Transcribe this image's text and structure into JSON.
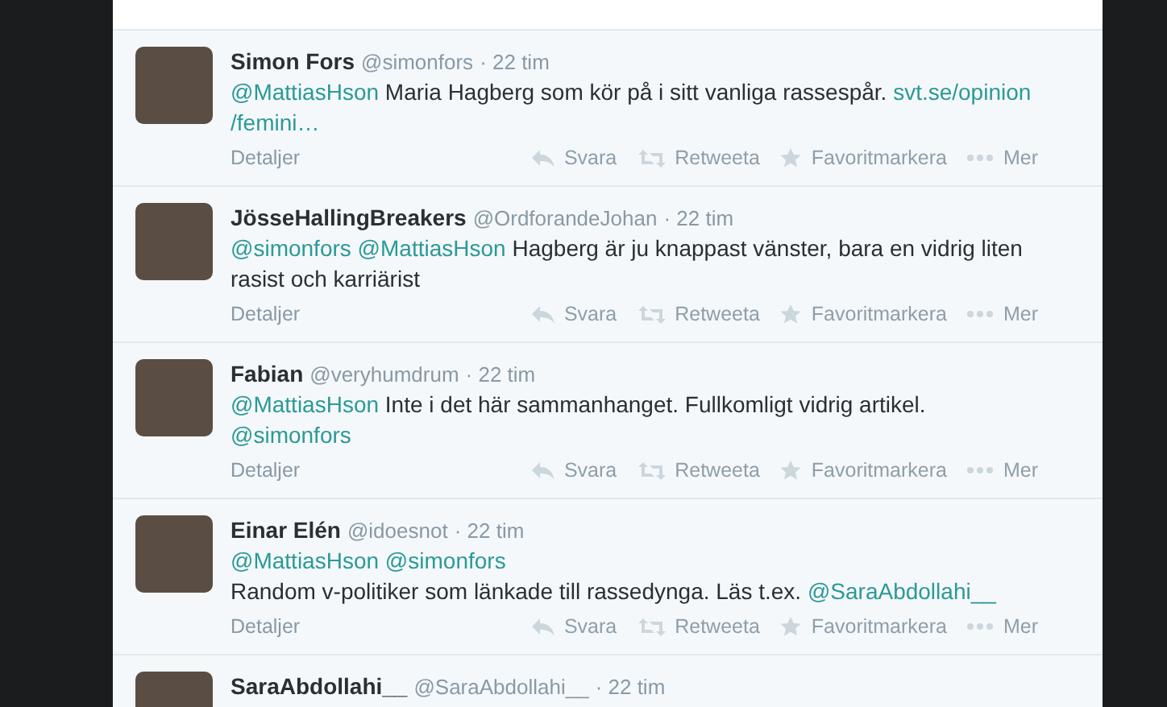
{
  "tweets": [
    {
      "name": "Simon Fors",
      "handle": "@simonfors",
      "time": "· 22 tim",
      "lines": [
        [
          {
            "kind": "mention",
            "text": "@MattiasHson"
          },
          {
            "kind": "text",
            "text": "Maria Hagberg som kör på i sitt vanliga rassespår."
          },
          {
            "kind": "link",
            "text": "svt.se/opinion"
          }
        ],
        [
          {
            "kind": "link",
            "text": "/femini…"
          }
        ]
      ],
      "details": "Detaljer",
      "actions": [
        {
          "kind": "reply",
          "label": "Svara"
        },
        {
          "kind": "retweet",
          "label": "Retweeta"
        },
        {
          "kind": "favorite",
          "label": "Favoritmarkera"
        },
        {
          "kind": "more",
          "label": "Mer"
        }
      ]
    },
    {
      "name": "JösseHallingBreakers",
      "handle": "@OrdforandeJohan",
      "time": "· 22 tim",
      "lines": [
        [
          {
            "kind": "mention",
            "text": "@simonfors"
          },
          {
            "kind": "mention",
            "text": "@MattiasHson"
          },
          {
            "kind": "text",
            "text": "Hagberg är ju knappast vänster, bara en vidrig liten rasist och karriärist"
          }
        ]
      ],
      "details": "Detaljer",
      "actions": [
        {
          "kind": "reply",
          "label": "Svara"
        },
        {
          "kind": "retweet",
          "label": "Retweeta"
        },
        {
          "kind": "favorite",
          "label": "Favoritmarkera"
        },
        {
          "kind": "more",
          "label": "Mer"
        }
      ]
    },
    {
      "name": "Fabian",
      "handle": "@veryhumdrum",
      "time": "· 22 tim",
      "lines": [
        [
          {
            "kind": "mention",
            "text": "@MattiasHson"
          },
          {
            "kind": "text",
            "text": "Inte i det här sammanhanget. Fullkomligt vidrig artikel."
          }
        ],
        [
          {
            "kind": "mention",
            "text": "@simonfors"
          }
        ]
      ],
      "details": "Detaljer",
      "actions": [
        {
          "kind": "reply",
          "label": "Svara"
        },
        {
          "kind": "retweet",
          "label": "Retweeta"
        },
        {
          "kind": "favorite",
          "label": "Favoritmarkera"
        },
        {
          "kind": "more",
          "label": "Mer"
        }
      ]
    },
    {
      "name": "Einar Elén",
      "handle": "@idoesnot",
      "time": "· 22 tim",
      "lines": [
        [
          {
            "kind": "mention",
            "text": "@MattiasHson"
          },
          {
            "kind": "mention",
            "text": "@simonfors"
          }
        ],
        [
          {
            "kind": "text",
            "text": "Random v-politiker som länkade till rassedynga. Läs t.ex."
          },
          {
            "kind": "mention",
            "text": "@SaraAbdollahi__"
          }
        ]
      ],
      "details": "Detaljer",
      "actions": [
        {
          "kind": "reply",
          "label": "Svara"
        },
        {
          "kind": "retweet",
          "label": "Retweeta"
        },
        {
          "kind": "favorite",
          "label": "Favoritmarkera"
        },
        {
          "kind": "more",
          "label": "Mer"
        }
      ]
    },
    {
      "name": "SaraAbdollahi__",
      "handle": "@SaraAbdollahi__",
      "time": "· 22 tim"
    }
  ]
}
